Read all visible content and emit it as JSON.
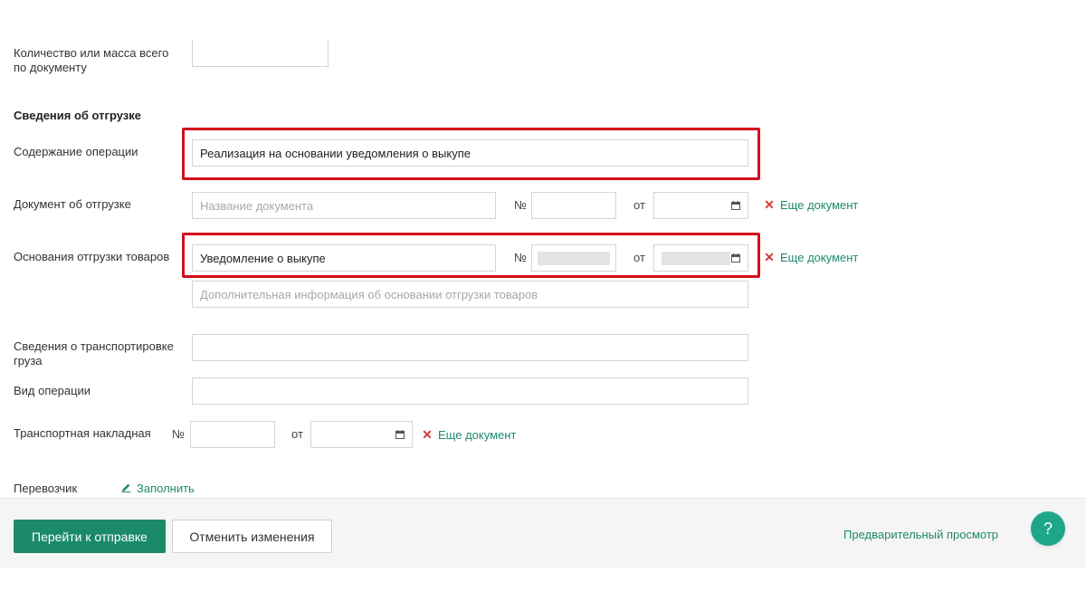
{
  "quantity": {
    "label": "Количество или масса всего по документу",
    "value": ""
  },
  "shipment_section": {
    "title": "Сведения об отгрузке"
  },
  "operation_content": {
    "label": "Содержание операции",
    "value": "Реализация на основании уведомления о выкупе"
  },
  "shipment_document": {
    "label": "Документ об отгрузке",
    "name_placeholder": "Название документа",
    "number_sign": "№",
    "from_label": "от",
    "more_label": "Еще документ"
  },
  "shipment_basis": {
    "label": "Основания отгрузки товаров",
    "name_value": "Уведомление о выкупе",
    "number_sign": "№",
    "from_label": "от",
    "more_label": "Еще документ",
    "extra_placeholder": "Дополнительная информация об основании отгрузки товаров"
  },
  "transport_info": {
    "label": "Сведения о транспортировке груза",
    "value": ""
  },
  "operation_type": {
    "label": "Вид операции",
    "value": ""
  },
  "waybill": {
    "label": "Транспортная накладная",
    "number_sign": "№",
    "from_label": "от",
    "more_label": "Еще документ"
  },
  "carrier": {
    "label": "Перевозчик",
    "fill_label": "Заполнить"
  },
  "footer": {
    "submit_label": "Перейти к отправке",
    "cancel_label": "Отменить изменения",
    "preview_label": "Предварительный просмотр",
    "help_label": "?"
  },
  "colors": {
    "accent": "#1a8a6a",
    "link": "#1e8a6e",
    "highlight": "#d40f1c",
    "remove": "#d23b3b"
  },
  "icons": [
    "calendar-icon",
    "remove-icon",
    "pencil-icon",
    "help-icon"
  ]
}
